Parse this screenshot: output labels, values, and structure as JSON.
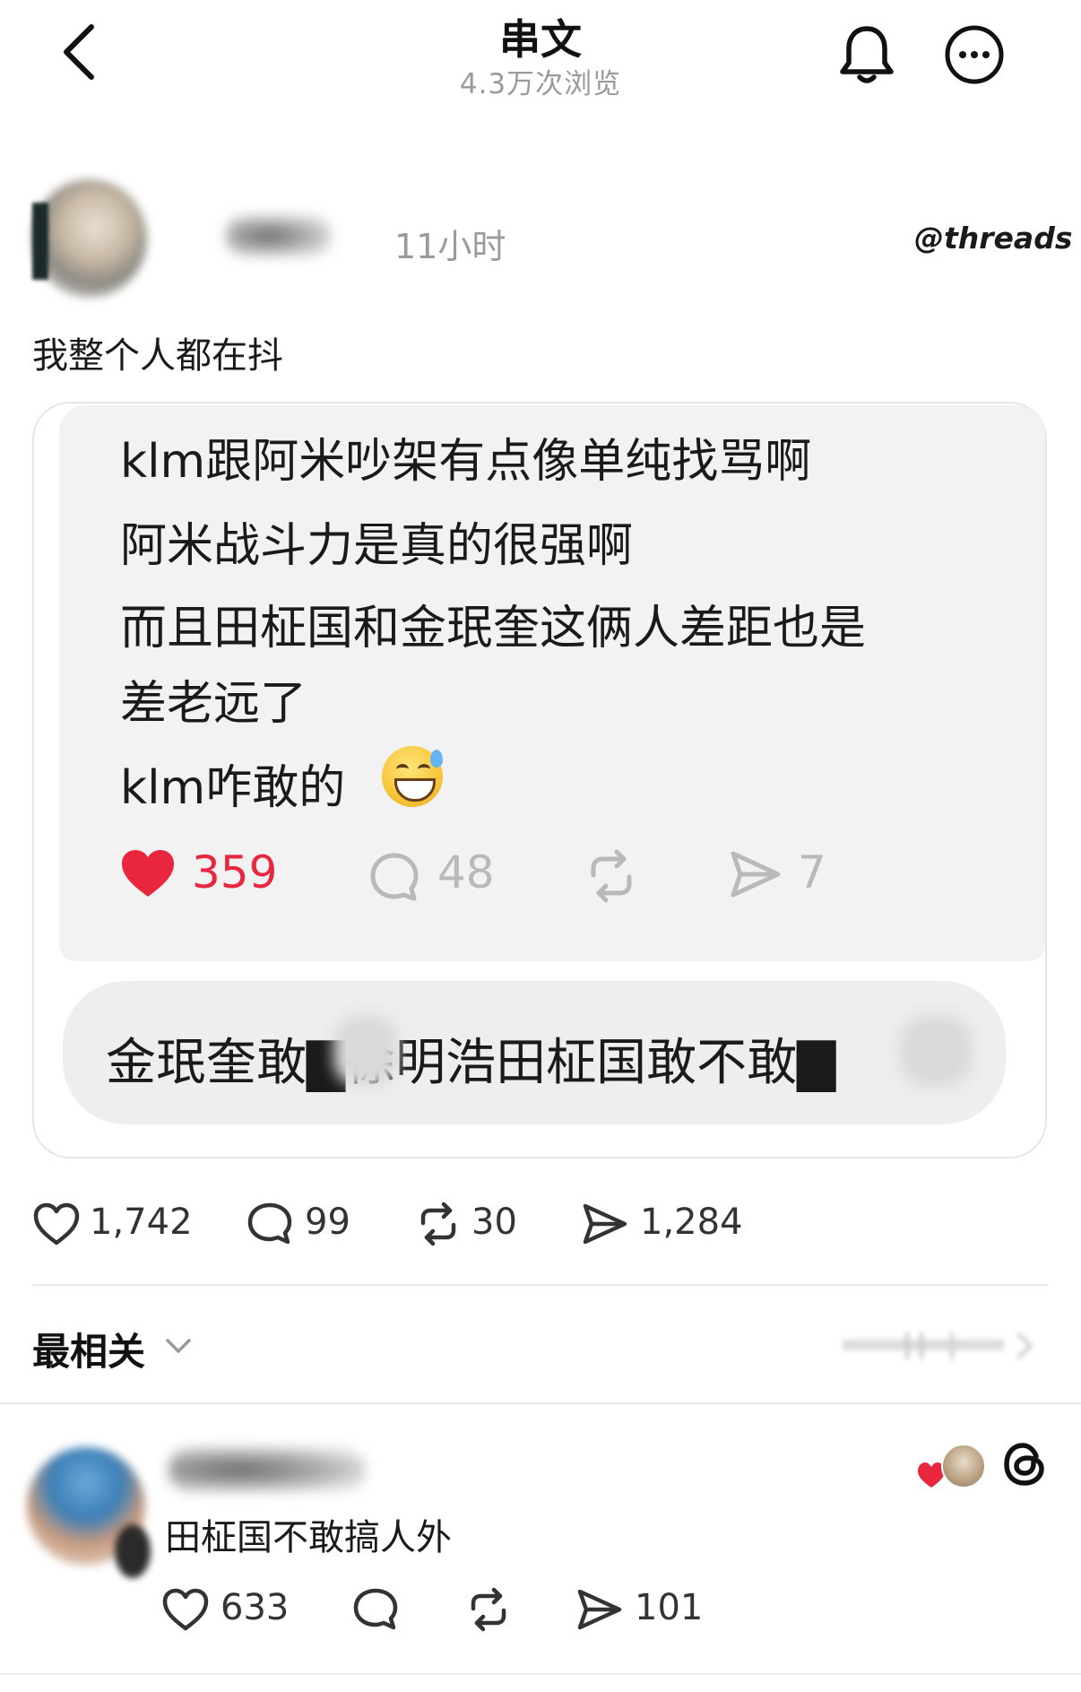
{
  "header": {
    "title": "串文",
    "subtitle": "4.3万次浏览"
  },
  "post": {
    "time": "11小时",
    "brand": "threads",
    "text": "我整个人都在抖",
    "quoted_screenshot": {
      "lines": [
        "klm跟阿米吵架有点像单纯找骂啊",
        "阿米战斗力是真的很强啊",
        "而且田柾国和金珉奎这俩人差距也是",
        "差老远了",
        "klm咋敢的"
      ],
      "emoji": "grinning-sweat-emoji",
      "likes": "359",
      "comments": "48",
      "shares": "7",
      "reply_text": "金珉奎敢▇徐明浩田柾国敢不敢▇"
    },
    "stats": {
      "likes": "1,742",
      "comments": "99",
      "reposts": "30",
      "shares": "1,284"
    }
  },
  "sort": {
    "label": "最相关"
  },
  "comment": {
    "text": "田柾国不敢搞人外",
    "likes": "633",
    "shares": "101"
  },
  "colors": {
    "like_red": "#e8263d",
    "muted_gray": "#9a9a9a",
    "card_bg": "#f2f2f2"
  }
}
